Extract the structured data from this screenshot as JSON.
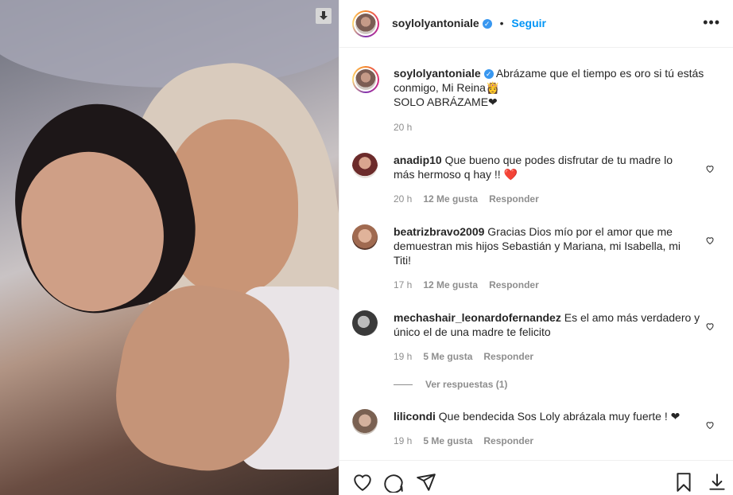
{
  "post": {
    "username": "soylolyantoniale",
    "follow_label": "Seguir",
    "separator": "•",
    "more_label": "•••",
    "caption": {
      "username": "soylolyantoniale",
      "text_line1": "Abrázame que el tiempo es oro si tú estás",
      "text_line2": "conmigo, Mi Reina👸",
      "text_line3": "SOLO ABRÁZAME❤",
      "time": "20 h"
    }
  },
  "comments": [
    {
      "username": "anadip10",
      "text": "Que bueno que podes disfrutar de tu madre lo más hermoso q hay !! ❤️",
      "time": "20 h",
      "likes": "12 Me gusta",
      "reply": "Responder",
      "avatar_color": "#6c2b2b"
    },
    {
      "username": "beatrizbravo2009",
      "text": "Gracias Dios mío por el amor que me demuestran mis hijos Sebastián y Mariana, mi Isabella, mi Titi!",
      "time": "17 h",
      "likes": "12 Me gusta",
      "reply": "Responder",
      "avatar_color": "#a06a50"
    },
    {
      "username": "mechashair_leonardofernandez",
      "text": "Es el amo más verdadero y único el de una madre te felicito",
      "time": "19 h",
      "likes": "5 Me gusta",
      "reply": "Responder",
      "avatar_color": "#3a3a3a"
    },
    {
      "username": "lilicondi",
      "text": "Que bendecida Sos Loly abrázala muy fuerte ! ❤",
      "time": "19 h",
      "likes": "5 Me gusta",
      "reply": "Responder",
      "avatar_color": "#7a6152"
    }
  ],
  "view_replies": "Ver respuestas (1)",
  "icons": {
    "like": "heart-icon",
    "comment": "comment-bubble-icon",
    "share": "paper-plane-icon",
    "save": "bookmark-icon",
    "download": "download-arrow-icon"
  },
  "colors": {
    "accent": "#0095f6",
    "muted": "#8e8e8e",
    "text": "#262626",
    "verified": "#3897f0"
  }
}
